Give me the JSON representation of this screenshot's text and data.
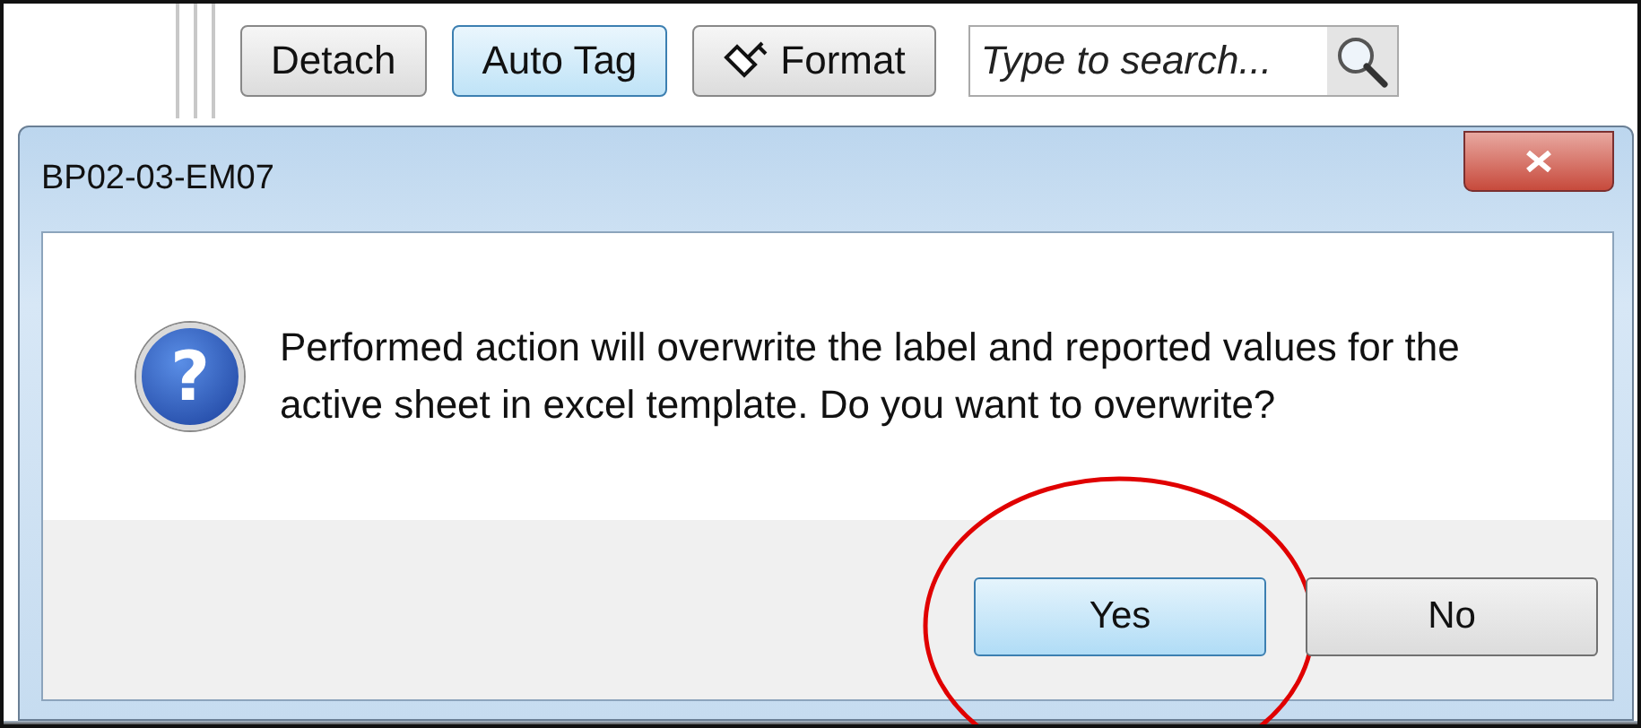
{
  "toolbar": {
    "buttons": [
      {
        "label": "Detach",
        "selected": false,
        "kind": "text"
      },
      {
        "label": "Auto Tag",
        "selected": true,
        "kind": "text"
      },
      {
        "label": "Format",
        "selected": false,
        "kind": "brush"
      }
    ],
    "search": {
      "placeholder": "Type to search..."
    }
  },
  "dialog": {
    "title": "BP02-03-EM07",
    "icon_glyph": "?",
    "message": "Performed action will overwrite the label and reported values for the active sheet in excel template. Do you want to overwrite?",
    "buttons": [
      {
        "label": "Yes",
        "focused": true,
        "circled": true
      },
      {
        "label": "No",
        "focused": false,
        "circled": false
      }
    ]
  }
}
